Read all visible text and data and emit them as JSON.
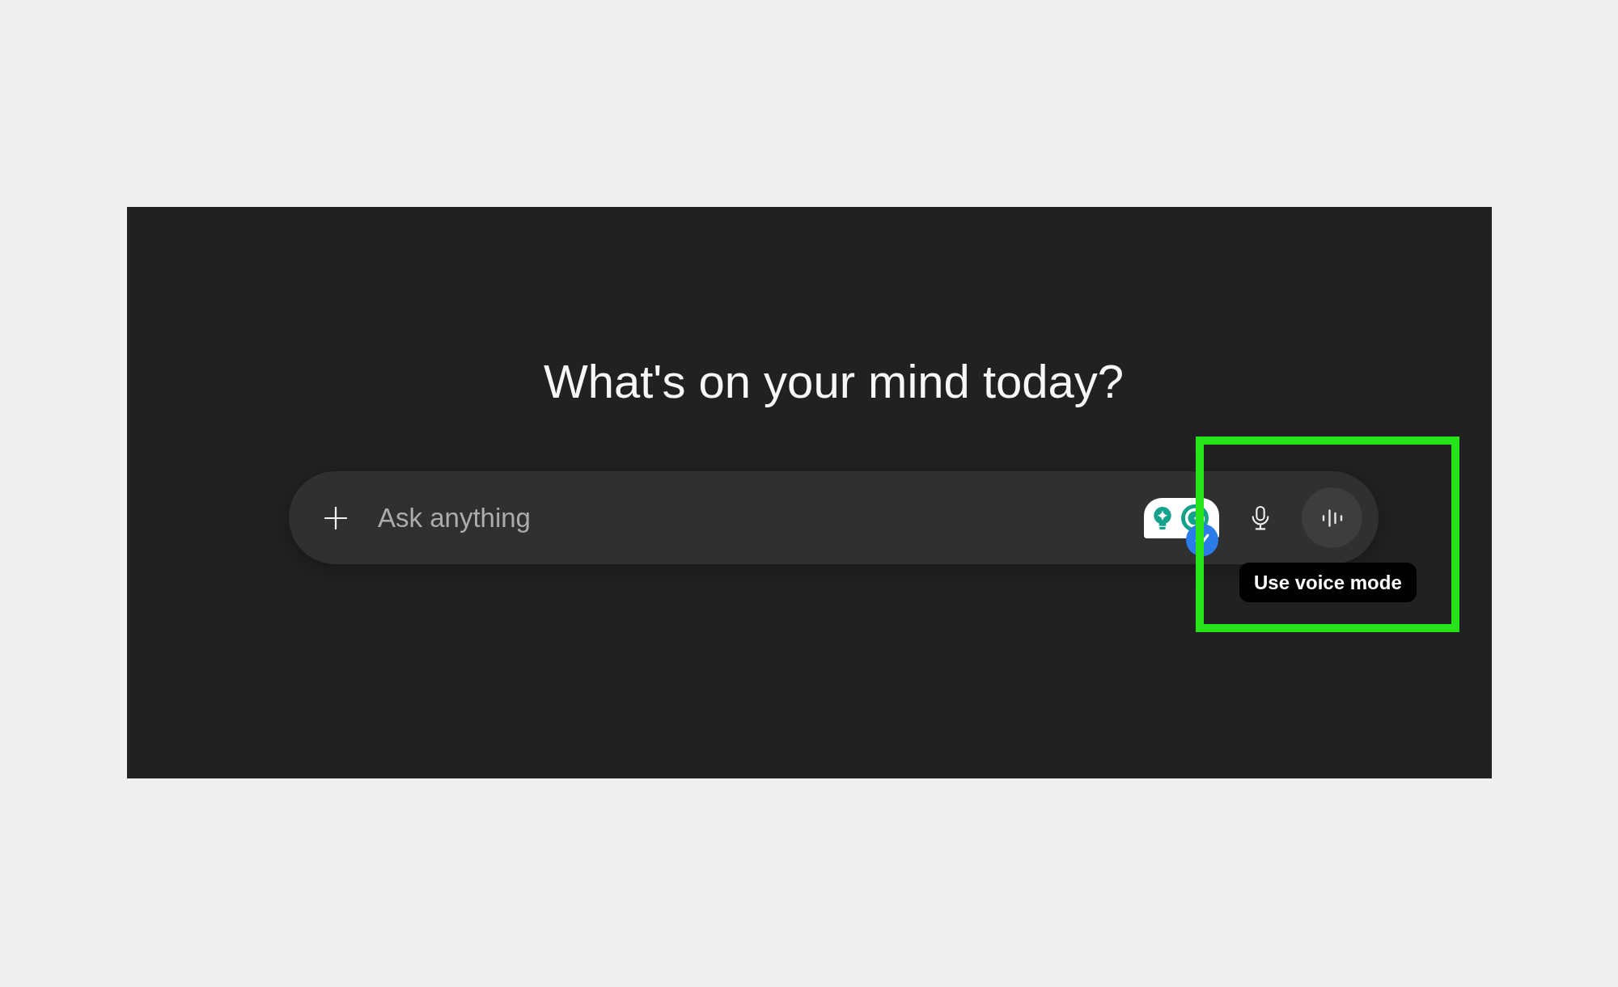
{
  "heading": "What's on your mind today?",
  "composer": {
    "placeholder": "Ask anything"
  },
  "tooltip": "Use voice mode"
}
